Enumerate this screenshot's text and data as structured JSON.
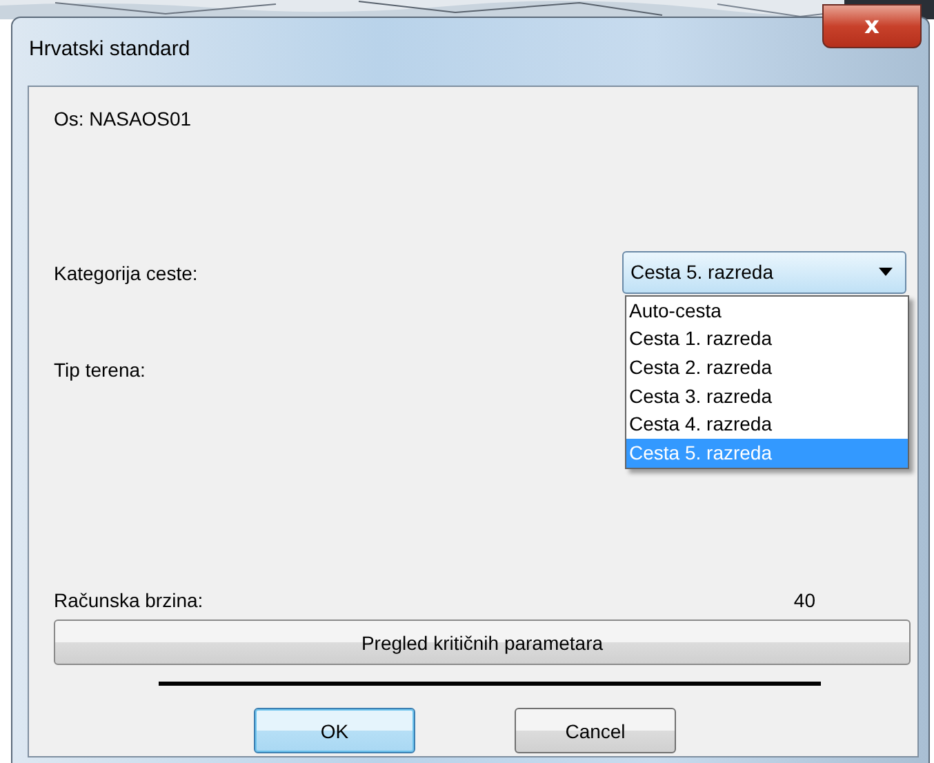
{
  "window": {
    "title": "Hrvatski standard",
    "close": "x"
  },
  "axis_label": "Os: NASAOS01",
  "road_category": {
    "label": "Kategorija ceste:",
    "value": "Cesta 5. razreda",
    "expanded": true,
    "options": [
      {
        "label": "Auto-cesta",
        "selected": false
      },
      {
        "label": "Cesta 1. razreda",
        "selected": false
      },
      {
        "label": "Cesta 2. razreda",
        "selected": false
      },
      {
        "label": "Cesta 3. razreda",
        "selected": false
      },
      {
        "label": "Cesta 4. razreda",
        "selected": false
      },
      {
        "label": "Cesta 5. razreda",
        "selected": true
      }
    ]
  },
  "terrain": {
    "label": "Tip terena:"
  },
  "design_speed": {
    "label": "Računska brzina:",
    "value": "40"
  },
  "review_button": "Pregled kritičnih parametara",
  "buttons": [
    {
      "label": "OK",
      "default": true
    },
    {
      "label": "Cancel",
      "default": false
    }
  ]
}
